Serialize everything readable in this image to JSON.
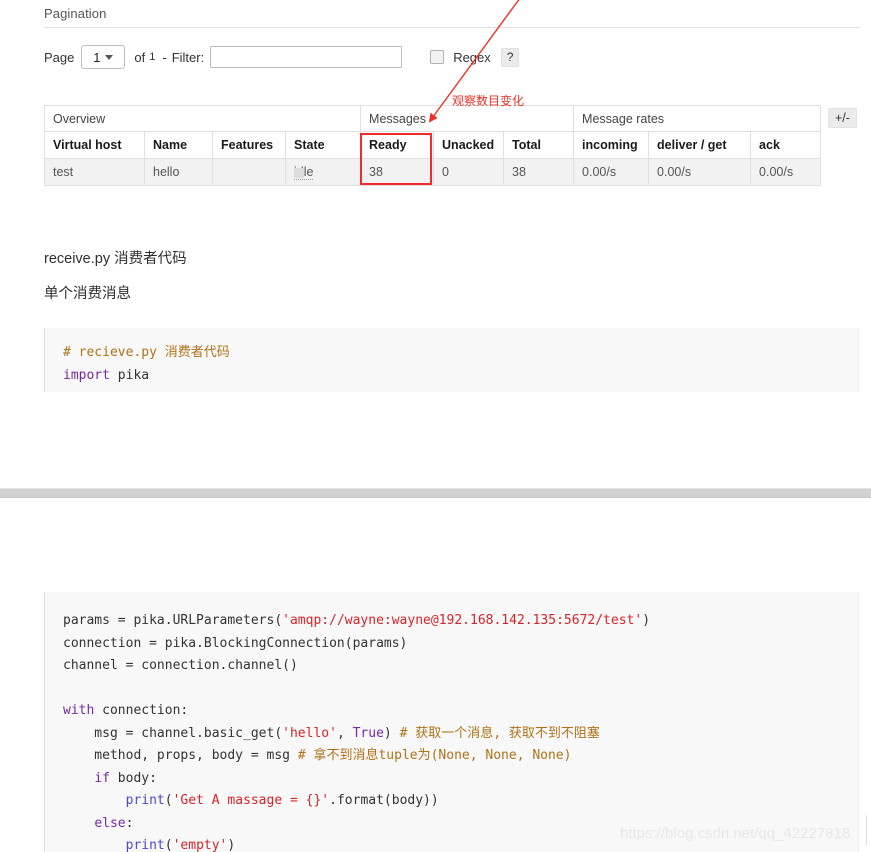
{
  "pagination": {
    "section_title": "Pagination",
    "page_label": "Page",
    "page_value": "1",
    "of_label": "of",
    "total_pages": "1",
    "dash": "-",
    "filter_label": "Filter:",
    "filter_value": "",
    "filter_placeholder": "",
    "regex_label": "Regex",
    "help_label": "?"
  },
  "table": {
    "group_headers": [
      {
        "label": "Overview",
        "span": 4
      },
      {
        "label": "Messages",
        "span": 3
      },
      {
        "label": "Message rates",
        "span": 3
      }
    ],
    "columns": [
      "Virtual host",
      "Name",
      "Features",
      "State",
      "Ready",
      "Unacked",
      "Total",
      "incoming",
      "deliver / get",
      "ack"
    ],
    "rows": [
      {
        "virtual_host": "test",
        "name": "hello",
        "features": "",
        "state": "idle",
        "ready": "38",
        "unacked": "0",
        "total": "38",
        "incoming": "0.00/s",
        "deliver_get": "0.00/s",
        "ack": "0.00/s"
      }
    ],
    "toggle_columns_label": "+/-"
  },
  "annotation": {
    "text": "观察数目变化",
    "color": "#e8332a",
    "highlights": [
      "Ready"
    ]
  },
  "headings": {
    "receive_py": "receive.py 消费者代码",
    "single_consume": "单个消费消息"
  },
  "code_top": {
    "lines": [
      [
        {
          "t": "# recieve.py 消费者代码",
          "c": "com"
        }
      ],
      [
        {
          "t": "import",
          "c": "kw"
        },
        {
          "t": " pika",
          "c": "plain"
        }
      ]
    ]
  },
  "code_main": {
    "lines": [
      [
        {
          "t": "params = pika.URLParameters(",
          "c": "plain"
        },
        {
          "t": "'amqp://wayne:wayne@192.168.142.135:5672/test'",
          "c": "str"
        },
        {
          "t": ")",
          "c": "plain"
        }
      ],
      [
        {
          "t": "connection = pika.BlockingConnection(params)",
          "c": "plain"
        }
      ],
      [
        {
          "t": "channel = connection.channel()",
          "c": "plain"
        }
      ],
      [
        {
          "t": "",
          "c": "plain"
        }
      ],
      [
        {
          "t": "with",
          "c": "kw"
        },
        {
          "t": " connection:",
          "c": "plain"
        }
      ],
      [
        {
          "t": "    msg = channel.basic_get(",
          "c": "plain"
        },
        {
          "t": "'hello'",
          "c": "str"
        },
        {
          "t": ", ",
          "c": "plain"
        },
        {
          "t": "True",
          "c": "kw"
        },
        {
          "t": ") ",
          "c": "plain"
        },
        {
          "t": "# 获取一个消息, 获取不到不阻塞",
          "c": "com"
        }
      ],
      [
        {
          "t": "    method, props, body = msg ",
          "c": "plain"
        },
        {
          "t": "# 拿不到消息tuple为(None, None, None)",
          "c": "com"
        }
      ],
      [
        {
          "t": "    ",
          "c": "plain"
        },
        {
          "t": "if",
          "c": "kw"
        },
        {
          "t": " body:",
          "c": "plain"
        }
      ],
      [
        {
          "t": "        ",
          "c": "plain"
        },
        {
          "t": "print",
          "c": "fn"
        },
        {
          "t": "(",
          "c": "plain"
        },
        {
          "t": "'Get A massage = {}'",
          "c": "str"
        },
        {
          "t": ".format(body))",
          "c": "plain"
        }
      ],
      [
        {
          "t": "    ",
          "c": "plain"
        },
        {
          "t": "else",
          "c": "kw"
        },
        {
          "t": ":",
          "c": "plain"
        }
      ],
      [
        {
          "t": "        ",
          "c": "plain"
        },
        {
          "t": "print",
          "c": "fn"
        },
        {
          "t": "(",
          "c": "plain"
        },
        {
          "t": "'empty'",
          "c": "str"
        },
        {
          "t": ")",
          "c": "plain"
        }
      ]
    ]
  },
  "watermark": {
    "text": "https://blog.csdn.net/qq_42227818"
  }
}
